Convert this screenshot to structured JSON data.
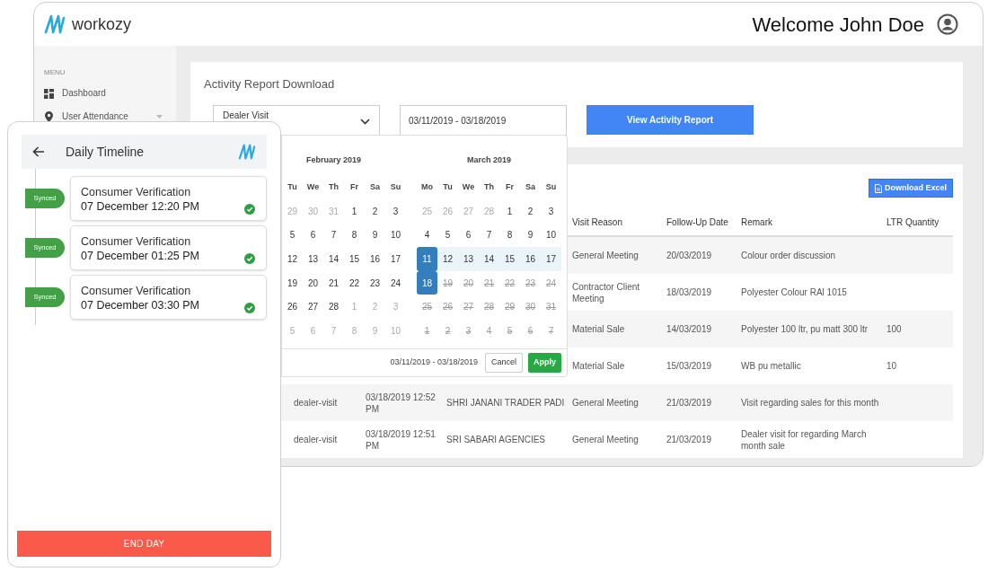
{
  "app": {
    "brand": "workozy",
    "greeting": "Welcome John Doe"
  },
  "sidebar": {
    "heading": "MENU",
    "items": [
      {
        "label": "Dashboard",
        "expandable": false
      },
      {
        "label": "User Attendance",
        "expandable": true
      }
    ]
  },
  "report_card": {
    "title": "Activity Report Download",
    "activity_type": "Dealer Visit",
    "date_range": "03/11/2019 - 03/18/2019",
    "button": "View Activity Report"
  },
  "date_picker": {
    "months": [
      {
        "title": "February 2019",
        "weekdays": [
          "Tu",
          "We",
          "Th",
          "Fr",
          "Sa",
          "Su"
        ],
        "weeks": [
          [
            {
              "day": "29",
              "kind": "muted",
              "selected": false
            },
            {
              "day": "30",
              "kind": "muted",
              "selected": false
            },
            {
              "day": "31",
              "kind": "muted",
              "selected": false
            },
            {
              "day": "1",
              "kind": "normal",
              "selected": false
            },
            {
              "day": "2",
              "kind": "normal",
              "selected": false
            },
            {
              "day": "3",
              "kind": "normal",
              "selected": false
            }
          ],
          [
            {
              "day": "5",
              "kind": "normal",
              "selected": false
            },
            {
              "day": "6",
              "kind": "normal",
              "selected": false
            },
            {
              "day": "7",
              "kind": "normal",
              "selected": false
            },
            {
              "day": "8",
              "kind": "normal",
              "selected": false
            },
            {
              "day": "9",
              "kind": "normal",
              "selected": false
            },
            {
              "day": "10",
              "kind": "normal",
              "selected": false
            }
          ],
          [
            {
              "day": "12",
              "kind": "normal",
              "selected": false
            },
            {
              "day": "13",
              "kind": "normal",
              "selected": false
            },
            {
              "day": "14",
              "kind": "normal",
              "selected": false
            },
            {
              "day": "15",
              "kind": "normal",
              "selected": false
            },
            {
              "day": "16",
              "kind": "normal",
              "selected": false
            },
            {
              "day": "17",
              "kind": "normal",
              "selected": false
            }
          ],
          [
            {
              "day": "19",
              "kind": "normal",
              "selected": false
            },
            {
              "day": "20",
              "kind": "normal",
              "selected": false
            },
            {
              "day": "21",
              "kind": "normal",
              "selected": false
            },
            {
              "day": "22",
              "kind": "normal",
              "selected": false
            },
            {
              "day": "23",
              "kind": "normal",
              "selected": false
            },
            {
              "day": "24",
              "kind": "normal",
              "selected": false
            }
          ],
          [
            {
              "day": "26",
              "kind": "normal",
              "selected": false
            },
            {
              "day": "27",
              "kind": "normal",
              "selected": false
            },
            {
              "day": "28",
              "kind": "normal",
              "selected": false
            },
            {
              "day": "1",
              "kind": "muted",
              "selected": false
            },
            {
              "day": "2",
              "kind": "muted",
              "selected": false
            },
            {
              "day": "3",
              "kind": "muted",
              "selected": false
            }
          ],
          [
            {
              "day": "5",
              "kind": "muted",
              "selected": false
            },
            {
              "day": "6",
              "kind": "muted",
              "selected": false
            },
            {
              "day": "7",
              "kind": "muted",
              "selected": false
            },
            {
              "day": "8",
              "kind": "muted",
              "selected": false
            },
            {
              "day": "9",
              "kind": "muted",
              "selected": false
            },
            {
              "day": "10",
              "kind": "muted",
              "selected": false
            }
          ]
        ]
      },
      {
        "title": "March 2019",
        "weekdays": [
          "Mo",
          "Tu",
          "We",
          "Th",
          "Fr",
          "Sa",
          "Su"
        ],
        "weeks": [
          [
            {
              "day": "25",
              "kind": "muted",
              "selected": false
            },
            {
              "day": "26",
              "kind": "muted",
              "selected": false
            },
            {
              "day": "27",
              "kind": "muted",
              "selected": false
            },
            {
              "day": "28",
              "kind": "muted",
              "selected": false
            },
            {
              "day": "1",
              "kind": "normal",
              "selected": false
            },
            {
              "day": "2",
              "kind": "normal",
              "selected": false
            },
            {
              "day": "3",
              "kind": "normal",
              "selected": false
            }
          ],
          [
            {
              "day": "4",
              "kind": "normal",
              "selected": false
            },
            {
              "day": "5",
              "kind": "normal",
              "selected": false
            },
            {
              "day": "6",
              "kind": "normal",
              "selected": false
            },
            {
              "day": "7",
              "kind": "normal",
              "selected": false
            },
            {
              "day": "8",
              "kind": "normal",
              "selected": false
            },
            {
              "day": "9",
              "kind": "normal",
              "selected": false
            },
            {
              "day": "10",
              "kind": "normal",
              "selected": false
            }
          ],
          [
            {
              "day": "11",
              "kind": "normal",
              "selected": true
            },
            {
              "day": "12",
              "kind": "in_range",
              "selected": false
            },
            {
              "day": "13",
              "kind": "in_range",
              "selected": false
            },
            {
              "day": "14",
              "kind": "in_range",
              "selected": false
            },
            {
              "day": "15",
              "kind": "in_range",
              "selected": false
            },
            {
              "day": "16",
              "kind": "in_range",
              "selected": false
            },
            {
              "day": "17",
              "kind": "in_range",
              "selected": false
            }
          ],
          [
            {
              "day": "18",
              "kind": "normal",
              "selected": true
            },
            {
              "day": "19",
              "kind": "disabled",
              "selected": false
            },
            {
              "day": "20",
              "kind": "disabled",
              "selected": false
            },
            {
              "day": "21",
              "kind": "disabled",
              "selected": false
            },
            {
              "day": "22",
              "kind": "disabled",
              "selected": false
            },
            {
              "day": "23",
              "kind": "disabled",
              "selected": false
            },
            {
              "day": "24",
              "kind": "disabled",
              "selected": false
            }
          ],
          [
            {
              "day": "25",
              "kind": "disabled",
              "selected": false
            },
            {
              "day": "26",
              "kind": "disabled",
              "selected": false
            },
            {
              "day": "27",
              "kind": "disabled",
              "selected": false
            },
            {
              "day": "28",
              "kind": "disabled",
              "selected": false
            },
            {
              "day": "29",
              "kind": "disabled",
              "selected": false
            },
            {
              "day": "30",
              "kind": "disabled",
              "selected": false
            },
            {
              "day": "31",
              "kind": "disabled",
              "selected": false
            }
          ],
          [
            {
              "day": "1",
              "kind": "disabled",
              "selected": false
            },
            {
              "day": "2",
              "kind": "disabled",
              "selected": false
            },
            {
              "day": "3",
              "kind": "disabled",
              "selected": false
            },
            {
              "day": "4",
              "kind": "disabled",
              "selected": false
            },
            {
              "day": "5",
              "kind": "disabled",
              "selected": false
            },
            {
              "day": "6",
              "kind": "disabled",
              "selected": false
            },
            {
              "day": "7",
              "kind": "disabled",
              "selected": false
            }
          ]
        ]
      }
    ],
    "range_label": "03/11/2019 - 03/18/2019",
    "cancel": "Cancel",
    "apply": "Apply"
  },
  "table": {
    "download_button": "Download Excel",
    "columns": [
      "Visit Reason",
      "Follow-Up Date",
      "Remark",
      "LTR Quantity"
    ],
    "rows": [
      {
        "visit_reason": "General Meeting",
        "follow_up_date": "20/03/2019",
        "remark": "Colour order discussion"
      },
      {
        "visit_reason": "Contractor Client Meeting",
        "follow_up_date": "18/03/2019",
        "remark": "Polyester Colour RAl 1015"
      },
      {
        "visit_reason": "Material Sale",
        "follow_up_date": "14/03/2019",
        "remark": "Polyester 100 ltr, pu matt 300 ltr",
        "ltr_quantity": "100"
      },
      {
        "visit_reason": "Material Sale",
        "follow_up_date": "15/03/2019",
        "remark": "WB pu metallic",
        "ltr_quantity": "10"
      },
      {
        "column_1": "dealer-visit",
        "column_2": "03/18/2019 12:52 PM",
        "column_3": "SHRI JANANI TRADER PADI",
        "visit_reason": "General Meeting",
        "follow_up_date": "21/03/2019",
        "remark": "Visit regarding sales for this month"
      },
      {
        "column_1": "dealer-visit",
        "column_2": "03/18/2019 12:51 PM",
        "column_3": "SRI SABARI AGENCIES",
        "visit_reason": "General Meeting",
        "follow_up_date": "21/03/2019",
        "remark": "Dealer visit for regarding March month sale"
      }
    ]
  },
  "phone": {
    "title": "Daily Timeline",
    "entries": [
      {
        "badge": "Synced",
        "title": "Consumer Verification",
        "time": "07 December 12:20 PM",
        "done": true
      },
      {
        "badge": "Synced",
        "title": "Consumer Verification",
        "time": "07 December 01:25 PM",
        "done": true
      },
      {
        "badge": "Synced",
        "title": "Consumer Verification",
        "time": "07 December 03:30 PM",
        "done": true
      }
    ],
    "end_button": "END DAY"
  }
}
